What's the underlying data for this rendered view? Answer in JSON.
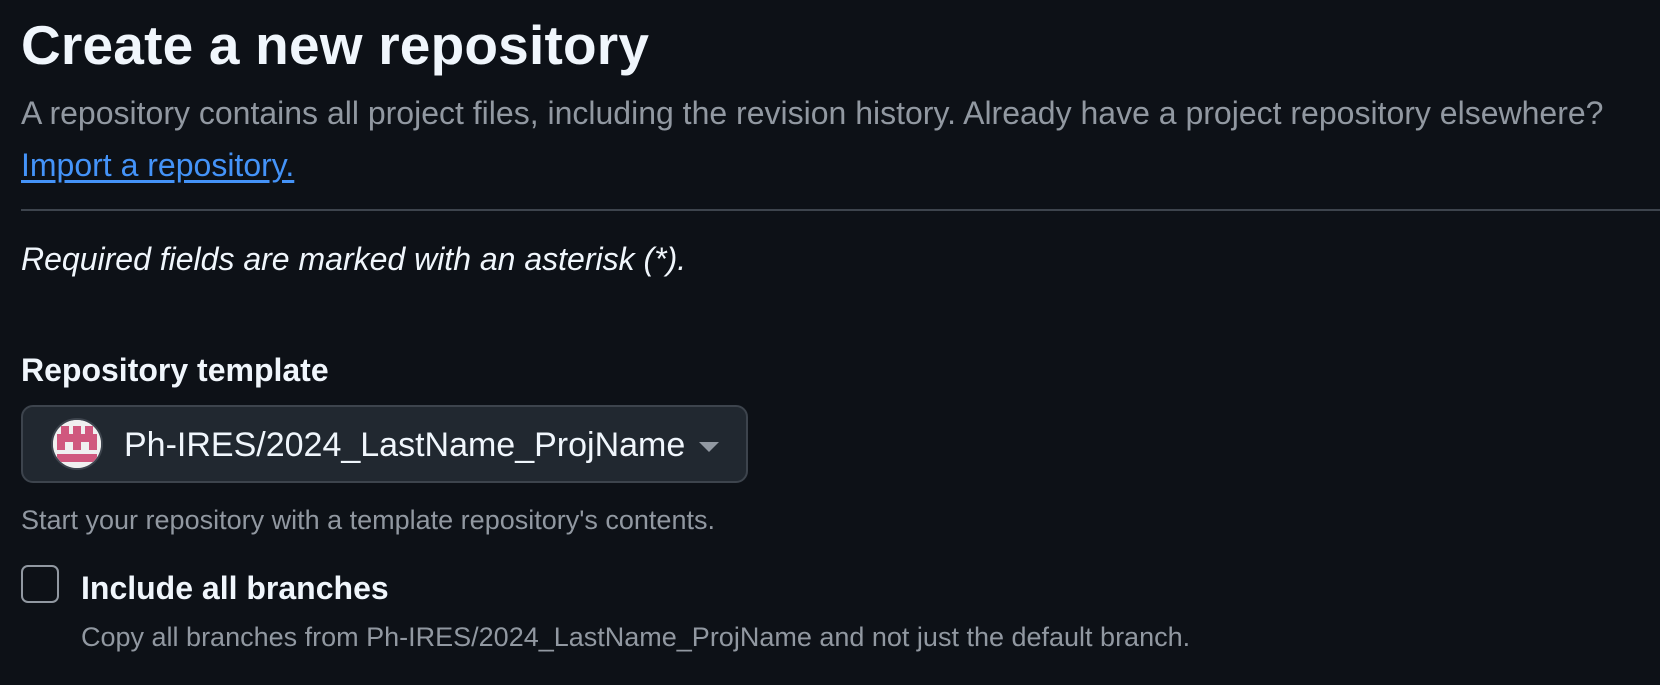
{
  "header": {
    "title": "Create a new repository",
    "description": "A repository contains all project files, including the revision history. Already have a project repository elsewhere? ",
    "import_link": "Import a repository."
  },
  "form": {
    "required_note": "Required fields are marked with an asterisk (*).",
    "template": {
      "label": "Repository template",
      "selected": "Ph-IRES/2024_LastName_ProjName",
      "hint": "Start your repository with a template repository's contents.",
      "avatar_icon": "org-avatar-icon"
    },
    "include_branches": {
      "label": "Include all branches",
      "hint": "Copy all branches from Ph-IRES/2024_LastName_ProjName and not just the default branch.",
      "checked": false
    }
  },
  "colors": {
    "background": "#0d1117",
    "link": "#4493f8",
    "muted_text": "#9198a1",
    "avatar_pink": "#d0587e"
  }
}
